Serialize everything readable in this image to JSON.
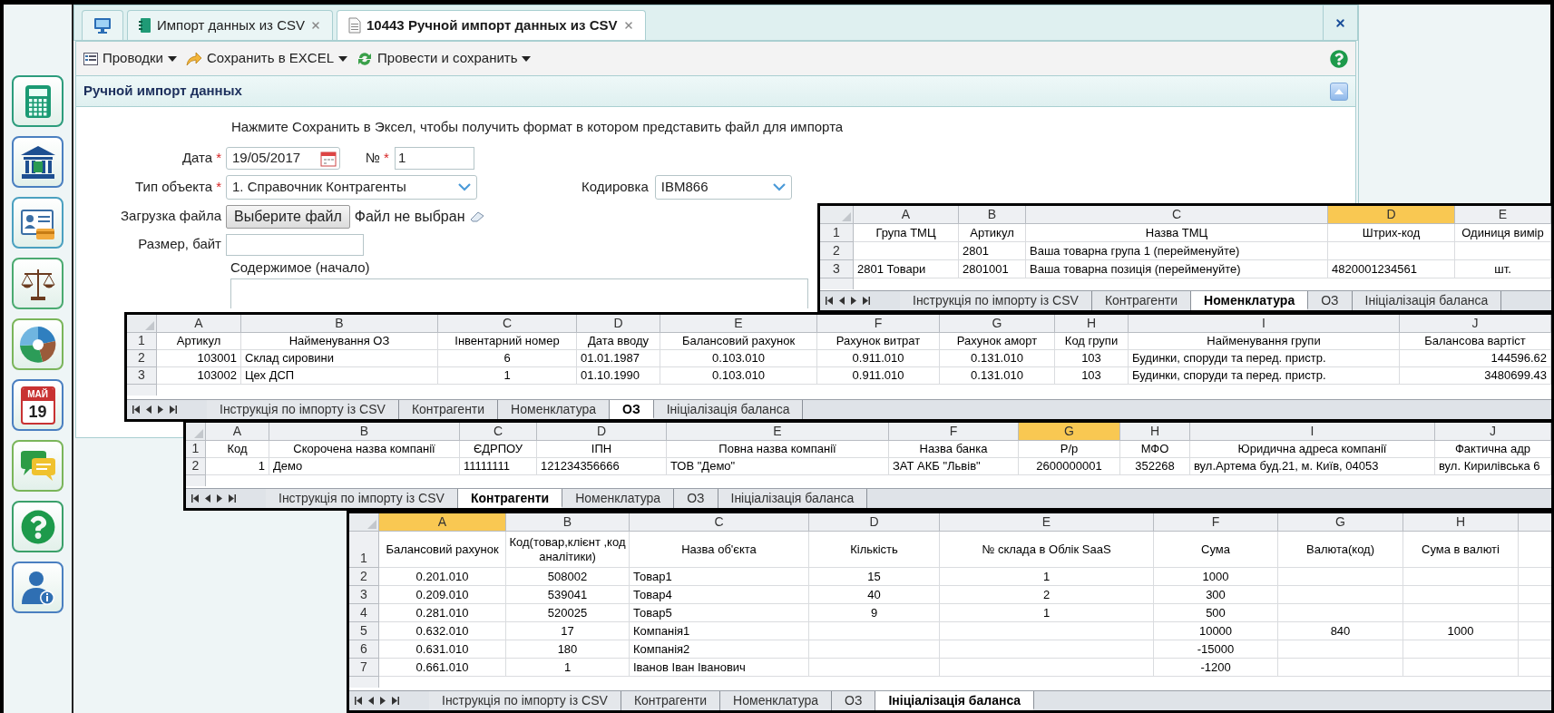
{
  "sidebar": [
    {
      "kind": "calculator"
    },
    {
      "kind": "bank"
    },
    {
      "kind": "id-card"
    },
    {
      "kind": "scales"
    },
    {
      "kind": "finance"
    },
    {
      "kind": "calendar",
      "month": "МАЙ",
      "day": "19"
    },
    {
      "kind": "chat"
    },
    {
      "kind": "help"
    },
    {
      "kind": "user"
    }
  ],
  "tabs": [
    {
      "kind": "home",
      "selected": false
    },
    {
      "kind": "notebook",
      "label": "Импорт данных из CSV",
      "selected": false
    },
    {
      "kind": "document",
      "label": "10443 Ручной импорт данных из CSV",
      "selected": true
    }
  ],
  "toolbar": [
    {
      "kind": "postings",
      "label": "Проводки"
    },
    {
      "kind": "export",
      "label": "Сохранить в EXCEL"
    },
    {
      "kind": "post",
      "label": "Провести и сохранить"
    }
  ],
  "section": {
    "title": "Ручной импорт данных",
    "expanded": true
  },
  "form": {
    "hint": "Нажмите Сохранить в Эксел, чтобы получить формат в котором представить файл для импорта",
    "date": {
      "label": "Дата",
      "required": "*",
      "value": "19/05/2017"
    },
    "number": {
      "label": "№",
      "required": "*",
      "value": "1"
    },
    "object_type": {
      "label": "Тип объекта",
      "required": "*",
      "value": "1. Справочник Контрагенты"
    },
    "encoding": {
      "label": "Кодировка",
      "value": "IBM866"
    },
    "file": {
      "label": "Загрузка файла",
      "button": "Выберите файл",
      "status": "Файл не выбран"
    },
    "size": {
      "label": "Размер, байт"
    },
    "content": {
      "label": "Содержимое (начало)"
    }
  },
  "sheets": [
    {
      "columns": [
        {
          "letter": "A",
          "selected": false
        },
        {
          "letter": "B",
          "selected": false
        },
        {
          "letter": "C",
          "selected": false
        },
        {
          "letter": "D",
          "selected": true
        },
        {
          "letter": "E",
          "selected": false
        }
      ],
      "rows": [
        {
          "number": "1",
          "cells": [
            "Група ТМЦ",
            "Артикул",
            "Назва ТМЦ",
            "Штрих-код",
            "Одиниця вимір"
          ]
        },
        {
          "number": "2",
          "cells": [
            null,
            "2801",
            "Ваша товарна група 1 (перейменуйте)",
            null,
            null
          ]
        },
        {
          "number": "3",
          "cells": [
            "2801 Товари",
            "2801001",
            "Ваша товарна позиція (перейменуйте)",
            "4820001234561",
            "шт."
          ]
        }
      ],
      "tabs": [
        {
          "label": "Інструкція по імпорту із CSV",
          "selected": false
        },
        {
          "label": "Контрагенти",
          "selected": false
        },
        {
          "label": "Номенклатура",
          "selected": true
        },
        {
          "label": "ОЗ",
          "selected": false
        },
        {
          "label": "Ініціалізація баланса",
          "selected": false
        }
      ]
    },
    {
      "columns": [
        {
          "letter": "A",
          "selected": false
        },
        {
          "letter": "B",
          "selected": false
        },
        {
          "letter": "C",
          "selected": false
        },
        {
          "letter": "D",
          "selected": false
        },
        {
          "letter": "E",
          "selected": false
        },
        {
          "letter": "F",
          "selected": false
        },
        {
          "letter": "G",
          "selected": false
        },
        {
          "letter": "H",
          "selected": false
        },
        {
          "letter": "I",
          "selected": false
        },
        {
          "letter": "J",
          "selected": false
        }
      ],
      "rows": [
        {
          "number": "1",
          "cells": [
            "Артикул",
            "Найменування ОЗ",
            "Інвентарний номер",
            "Дата вводу",
            "Балансовий рахунок",
            "Рахунок витрат",
            "Рахунок аморт",
            "Код групи",
            "Найменування групи",
            "Балансова вартіст"
          ]
        },
        {
          "number": "2",
          "cells": [
            "103001",
            "Склад сировини",
            "6",
            "01.01.1987",
            "0.103.010",
            "0.911.010",
            "0.131.010",
            "103",
            "Будинки, споруди та перед. пристр.",
            "144596.62"
          ]
        },
        {
          "number": "3",
          "cells": [
            "103002",
            "Цех ДСП",
            "1",
            "01.10.1990",
            "0.103.010",
            "0.911.010",
            "0.131.010",
            "103",
            "Будинки, споруди та перед. пристр.",
            "3480699.43"
          ]
        }
      ],
      "tabs": [
        {
          "label": "Інструкція по імпорту із CSV",
          "selected": false
        },
        {
          "label": "Контрагенти",
          "selected": false
        },
        {
          "label": "Номенклатура",
          "selected": false
        },
        {
          "label": "ОЗ",
          "selected": true
        },
        {
          "label": "Ініціалізація баланса",
          "selected": false
        }
      ]
    },
    {
      "columns": [
        {
          "letter": "A",
          "selected": false
        },
        {
          "letter": "B",
          "selected": false
        },
        {
          "letter": "C",
          "selected": false
        },
        {
          "letter": "D",
          "selected": false
        },
        {
          "letter": "E",
          "selected": false
        },
        {
          "letter": "F",
          "selected": false
        },
        {
          "letter": "G",
          "selected": true
        },
        {
          "letter": "H",
          "selected": false
        },
        {
          "letter": "I",
          "selected": false
        },
        {
          "letter": "J",
          "selected": false
        }
      ],
      "rows": [
        {
          "number": "1",
          "cells": [
            "Код",
            "Скорочена назва компанії",
            "ЄДРПОУ",
            "ІПН",
            "Повна назва компанії",
            "Назва банка",
            "Р/р",
            "МФО",
            "Юридична адреса компанії",
            "Фактична адр"
          ]
        },
        {
          "number": "2",
          "cells": [
            "1",
            "Демо",
            "11111111",
            "121234356666",
            "ТОВ \"Демо\"",
            "ЗАТ АКБ \"Львів\"",
            "2600000001",
            "352268",
            "вул.Артема буд.21, м. Київ, 04053",
            "вул. Кирилівська 6"
          ]
        }
      ],
      "tabs": [
        {
          "label": "Інструкція по імпорту із CSV",
          "selected": false
        },
        {
          "label": "Контрагенти",
          "selected": true
        },
        {
          "label": "Номенклатура",
          "selected": false
        },
        {
          "label": "ОЗ",
          "selected": false
        },
        {
          "label": "Ініціалізація баланса",
          "selected": false
        }
      ]
    },
    {
      "columns": [
        {
          "letter": "A",
          "selected": true
        },
        {
          "letter": "B",
          "selected": false
        },
        {
          "letter": "C",
          "selected": false
        },
        {
          "letter": "D",
          "selected": false
        },
        {
          "letter": "E",
          "selected": false
        },
        {
          "letter": "F",
          "selected": false
        },
        {
          "letter": "G",
          "selected": false
        },
        {
          "letter": "H",
          "selected": false
        }
      ],
      "rows": [
        {
          "number": "1",
          "cells": [
            "Балансовий рахунок",
            "Код(товар,клієнт ,код аналітики)",
            "Назва об'єкта",
            "Кількість",
            "№ склада в Облік SaaS",
            "Сума",
            "Валюта(код)",
            "Сума в валюті"
          ]
        },
        {
          "number": "2",
          "cells": [
            "0.201.010",
            "508002",
            "Товар1",
            "15",
            "1",
            "1000",
            null,
            null
          ]
        },
        {
          "number": "3",
          "cells": [
            "0.209.010",
            "539041",
            "Товар4",
            "40",
            "2",
            "300",
            null,
            null
          ]
        },
        {
          "number": "4",
          "cells": [
            "0.281.010",
            "520025",
            "Товар5",
            "9",
            "1",
            "500",
            null,
            null
          ]
        },
        {
          "number": "5",
          "cells": [
            "0.632.010",
            "17",
            "Компанія1",
            null,
            null,
            "10000",
            "840",
            "1000"
          ]
        },
        {
          "number": "6",
          "cells": [
            "0.631.010",
            "180",
            "Компанія2",
            null,
            null,
            "-15000",
            null,
            null
          ]
        },
        {
          "number": "7",
          "cells": [
            "0.661.010",
            "1",
            "Іванов Іван Іванович",
            null,
            null,
            "-1200",
            null,
            null
          ]
        }
      ],
      "tabs": [
        {
          "label": "Інструкція по імпорту із CSV",
          "selected": false
        },
        {
          "label": "Контрагенти",
          "selected": false
        },
        {
          "label": "Номенклатура",
          "selected": false
        },
        {
          "label": "ОЗ",
          "selected": false
        },
        {
          "label": "Ініціалізація баланса",
          "selected": true
        }
      ]
    }
  ]
}
